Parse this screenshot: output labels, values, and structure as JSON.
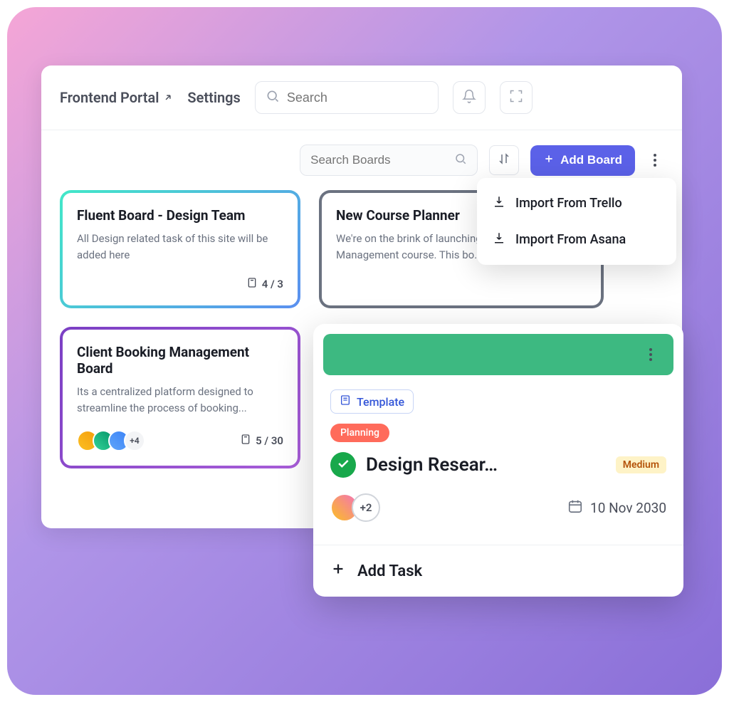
{
  "topbar": {
    "portal_label": "Frontend Portal",
    "settings_label": "Settings",
    "search_placeholder": "Search"
  },
  "toolbar": {
    "search_boards_placeholder": "Search Boards",
    "add_board_label": "Add Board"
  },
  "dropdown": {
    "items": [
      {
        "label": "Import From Trello"
      },
      {
        "label": "Import From Asana"
      }
    ]
  },
  "boards": [
    {
      "title": "Fluent Board - Design Team",
      "desc": "All Design related task of this site will be added here",
      "count": "4 / 3"
    },
    {
      "title": "New Course Planner",
      "desc": "We're on the brink of launching a new Project Management course. This bo..."
    },
    {
      "title": "Client Booking Management Board",
      "desc": "Its a centralized platform designed to streamline the process of booking...",
      "avatar_more": "+4",
      "count": "5 / 30"
    }
  ],
  "task": {
    "template_label": "Template",
    "tag": "Planning",
    "title": "Design Resear…",
    "priority": "Medium",
    "avatar_more": "+2",
    "date": "10 Nov 2030",
    "add_task_label": "Add Task"
  }
}
